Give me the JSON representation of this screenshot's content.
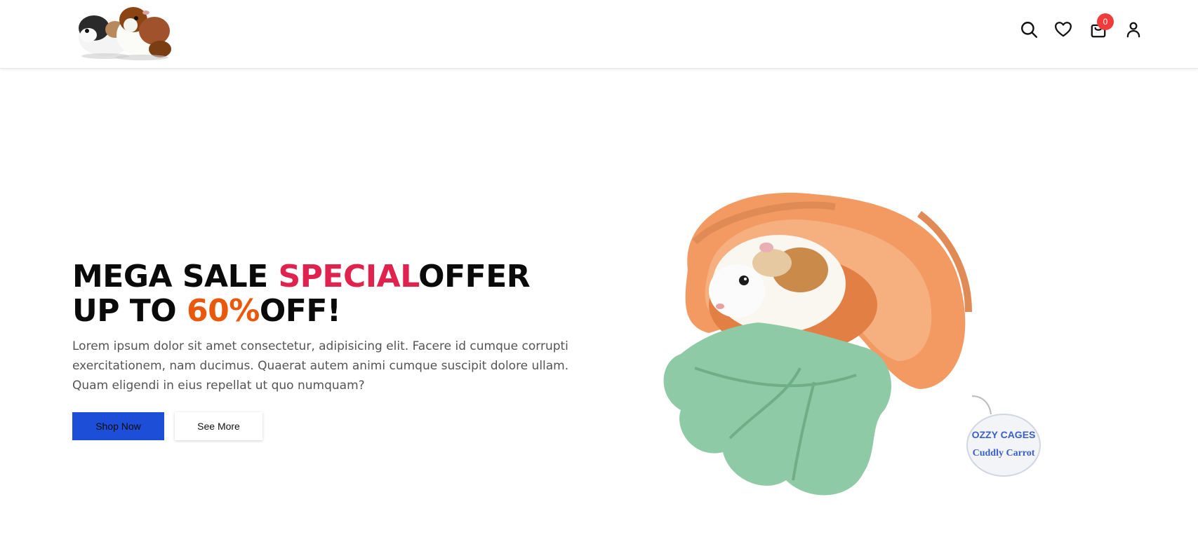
{
  "header": {
    "logo_alt": "Guinea pigs logo",
    "cart_count": "0"
  },
  "icons": [
    "search-icon",
    "heart-icon",
    "shopping-bag-icon",
    "user-icon"
  ],
  "hero": {
    "headline_part1": "MEGA SALE ",
    "headline_highlight1": "SPECIAL",
    "headline_part2": "OFFER UP TO ",
    "headline_highlight2": "60%",
    "headline_part3": "OFF!",
    "description": "Lorem ipsum dolor sit amet consectetur, adipisicing elit. Facere id cumque corrupti exercitationem, nam ducimus. Quaerat autem animi cumque suscipit dolore ullam. Quam eligendi in eius repellat ut quo numquam?",
    "primary_button": "Shop Now",
    "secondary_button": "See More",
    "image_alt": "Guinea pig in carrot cuddle bed",
    "tag_brand": "OZZY CAGES",
    "tag_product": "Cuddly Carrot"
  },
  "colors": {
    "accent_red": "#e0234e",
    "accent_orange": "#ea580c",
    "primary_button": "#1d4ed8",
    "badge": "#f23c3c"
  }
}
